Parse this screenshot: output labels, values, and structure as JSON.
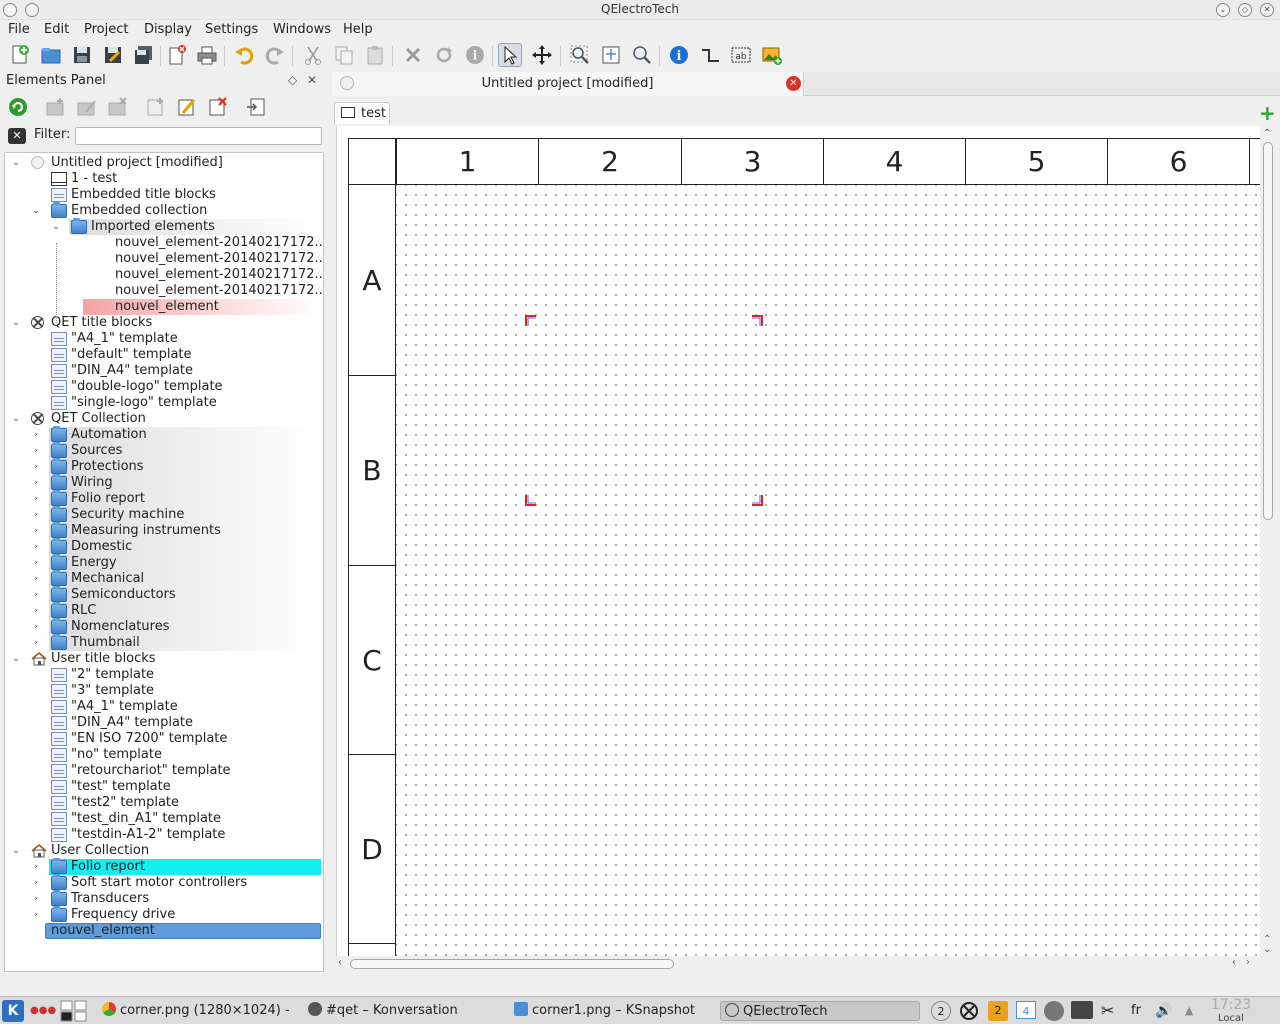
{
  "window": {
    "title": "QElectroTech"
  },
  "menu": [
    "File",
    "Edit",
    "Project",
    "Display",
    "Settings",
    "Windows",
    "Help"
  ],
  "toolbar_icons": [
    "new-project-icon",
    "open-icon",
    "save-icon",
    "save-as-icon",
    "save-all-icon",
    "close-project-icon",
    "print-icon",
    "undo-icon",
    "redo-icon",
    "cut-icon",
    "copy-icon",
    "paste-icon",
    "delete-icon",
    "rotate-icon",
    "properties-icon",
    "select-icon",
    "move-icon",
    "zoom-fit-icon",
    "zoom-content-icon",
    "zoom-icon",
    "info-icon",
    "conductor-icon",
    "textfield-icon",
    "add-image-icon"
  ],
  "panel": {
    "title": "Elements Panel",
    "float_glyph": "◇",
    "close_glyph": "✕",
    "filter_label": "Filter:",
    "filter_value": "",
    "filter_clear_glyph": "✕",
    "toolbar_icons": [
      "reload-icon",
      "new-category-icon",
      "edit-category-icon",
      "delete-category-icon",
      "new-element-icon",
      "edit-element-icon",
      "delete-element-icon",
      "import-element-icon"
    ]
  },
  "tree": [
    {
      "label": "Untitled project [modified]",
      "level": 0,
      "arrow": "open",
      "icon": "project"
    },
    {
      "label": "1 - test",
      "level": 1,
      "arrow": "none",
      "icon": "folio"
    },
    {
      "label": "Embedded title blocks",
      "level": 1,
      "arrow": "none",
      "icon": "titleblock"
    },
    {
      "label": "Embedded collection",
      "level": 1,
      "arrow": "open",
      "icon": "folder"
    },
    {
      "label": "Imported elements",
      "level": 2,
      "arrow": "open",
      "icon": "folder",
      "hl": "grey"
    },
    {
      "label": "nouvel_element-20140217172...",
      "level": 3,
      "arrow": "none",
      "icon": "none"
    },
    {
      "label": "nouvel_element-20140217172...",
      "level": 3,
      "arrow": "none",
      "icon": "none"
    },
    {
      "label": "nouvel_element-20140217172...",
      "level": 3,
      "arrow": "none",
      "icon": "none"
    },
    {
      "label": "nouvel_element-20140217172...",
      "level": 3,
      "arrow": "none",
      "icon": "none"
    },
    {
      "label": "nouvel_element",
      "level": 3,
      "arrow": "none",
      "icon": "none",
      "hl": "pink"
    },
    {
      "label": "QET title blocks",
      "level": 0,
      "arrow": "open",
      "icon": "qet"
    },
    {
      "label": "\"A4_1\" template",
      "level": 1,
      "arrow": "none",
      "icon": "titleblock"
    },
    {
      "label": "\"default\" template",
      "level": 1,
      "arrow": "none",
      "icon": "titleblock"
    },
    {
      "label": "\"DIN_A4\" template",
      "level": 1,
      "arrow": "none",
      "icon": "titleblock"
    },
    {
      "label": "\"double-logo\" template",
      "level": 1,
      "arrow": "none",
      "icon": "titleblock"
    },
    {
      "label": "\"single-logo\" template",
      "level": 1,
      "arrow": "none",
      "icon": "titleblock"
    },
    {
      "label": "QET Collection",
      "level": 0,
      "arrow": "open",
      "icon": "qet"
    },
    {
      "label": "Automation",
      "level": 1,
      "arrow": "closed",
      "icon": "folder",
      "hl": "grey"
    },
    {
      "label": "Sources",
      "level": 1,
      "arrow": "closed",
      "icon": "folder",
      "hl": "grey"
    },
    {
      "label": "Protections",
      "level": 1,
      "arrow": "closed",
      "icon": "folder",
      "hl": "grey"
    },
    {
      "label": "Wiring",
      "level": 1,
      "arrow": "closed",
      "icon": "folder",
      "hl": "grey"
    },
    {
      "label": "Folio report",
      "level": 1,
      "arrow": "closed",
      "icon": "folder",
      "hl": "grey"
    },
    {
      "label": "Security machine",
      "level": 1,
      "arrow": "closed",
      "icon": "folder",
      "hl": "grey"
    },
    {
      "label": "Measuring instruments",
      "level": 1,
      "arrow": "closed",
      "icon": "folder",
      "hl": "grey"
    },
    {
      "label": "Domestic",
      "level": 1,
      "arrow": "closed",
      "icon": "folder",
      "hl": "grey"
    },
    {
      "label": "Energy",
      "level": 1,
      "arrow": "closed",
      "icon": "folder",
      "hl": "grey"
    },
    {
      "label": "Mechanical",
      "level": 1,
      "arrow": "closed",
      "icon": "folder",
      "hl": "grey"
    },
    {
      "label": "Semiconductors",
      "level": 1,
      "arrow": "closed",
      "icon": "folder",
      "hl": "grey"
    },
    {
      "label": "RLC",
      "level": 1,
      "arrow": "closed",
      "icon": "folder",
      "hl": "grey"
    },
    {
      "label": "Nomenclatures",
      "level": 1,
      "arrow": "closed",
      "icon": "folder",
      "hl": "grey"
    },
    {
      "label": "Thumbnail",
      "level": 1,
      "arrow": "closed",
      "icon": "folder",
      "hl": "grey"
    },
    {
      "label": "User title blocks",
      "level": 0,
      "arrow": "open",
      "icon": "home"
    },
    {
      "label": "\"2\" template",
      "level": 1,
      "arrow": "none",
      "icon": "titleblock"
    },
    {
      "label": "\"3\" template",
      "level": 1,
      "arrow": "none",
      "icon": "titleblock"
    },
    {
      "label": "\"A4_1\" template",
      "level": 1,
      "arrow": "none",
      "icon": "titleblock"
    },
    {
      "label": "\"DIN_A4\" template",
      "level": 1,
      "arrow": "none",
      "icon": "titleblock"
    },
    {
      "label": "\"EN ISO 7200\" template",
      "level": 1,
      "arrow": "none",
      "icon": "titleblock"
    },
    {
      "label": "\"no\" template",
      "level": 1,
      "arrow": "none",
      "icon": "titleblock"
    },
    {
      "label": "\"retourchariot\" template",
      "level": 1,
      "arrow": "none",
      "icon": "titleblock"
    },
    {
      "label": "\"test\" template",
      "level": 1,
      "arrow": "none",
      "icon": "titleblock"
    },
    {
      "label": "\"test2\" template",
      "level": 1,
      "arrow": "none",
      "icon": "titleblock"
    },
    {
      "label": "\"test_din_A1\" template",
      "level": 1,
      "arrow": "none",
      "icon": "titleblock"
    },
    {
      "label": "\"testdin-A1-2\" template",
      "level": 1,
      "arrow": "none",
      "icon": "titleblock"
    },
    {
      "label": "User Collection",
      "level": 0,
      "arrow": "open",
      "icon": "home"
    },
    {
      "label": "Folio report",
      "level": 1,
      "arrow": "closed",
      "icon": "folder",
      "hl": "cyan"
    },
    {
      "label": "Soft start motor controllers",
      "level": 1,
      "arrow": "closed",
      "icon": "folder"
    },
    {
      "label": "Transducers",
      "level": 1,
      "arrow": "closed",
      "icon": "folder"
    },
    {
      "label": "Frequency drive",
      "level": 1,
      "arrow": "closed",
      "icon": "folder"
    },
    {
      "label": "nouvel_element",
      "level": 1,
      "arrow": "none",
      "icon": "none",
      "hl": "selected"
    }
  ],
  "document": {
    "tab_title": "Untitled project [modified]",
    "close_glyph": "✕",
    "folio_tab": "test",
    "add_folio_glyph": "+",
    "columns": [
      "1",
      "2",
      "3",
      "4",
      "5",
      "6"
    ],
    "rows": [
      "A",
      "B",
      "C",
      "D"
    ],
    "corner_color": "#d22a2a"
  },
  "taskbar": {
    "start_glyph": "K",
    "tasks": [
      "corner.png (1280×1024) - ",
      "#qet – Konversation",
      "corner1.png – KSnapshot",
      "QElectroTech"
    ],
    "desktop_num": "2",
    "tray_num": "4",
    "lang": "fr",
    "clock": "17:23",
    "clock_sub": "Local"
  }
}
